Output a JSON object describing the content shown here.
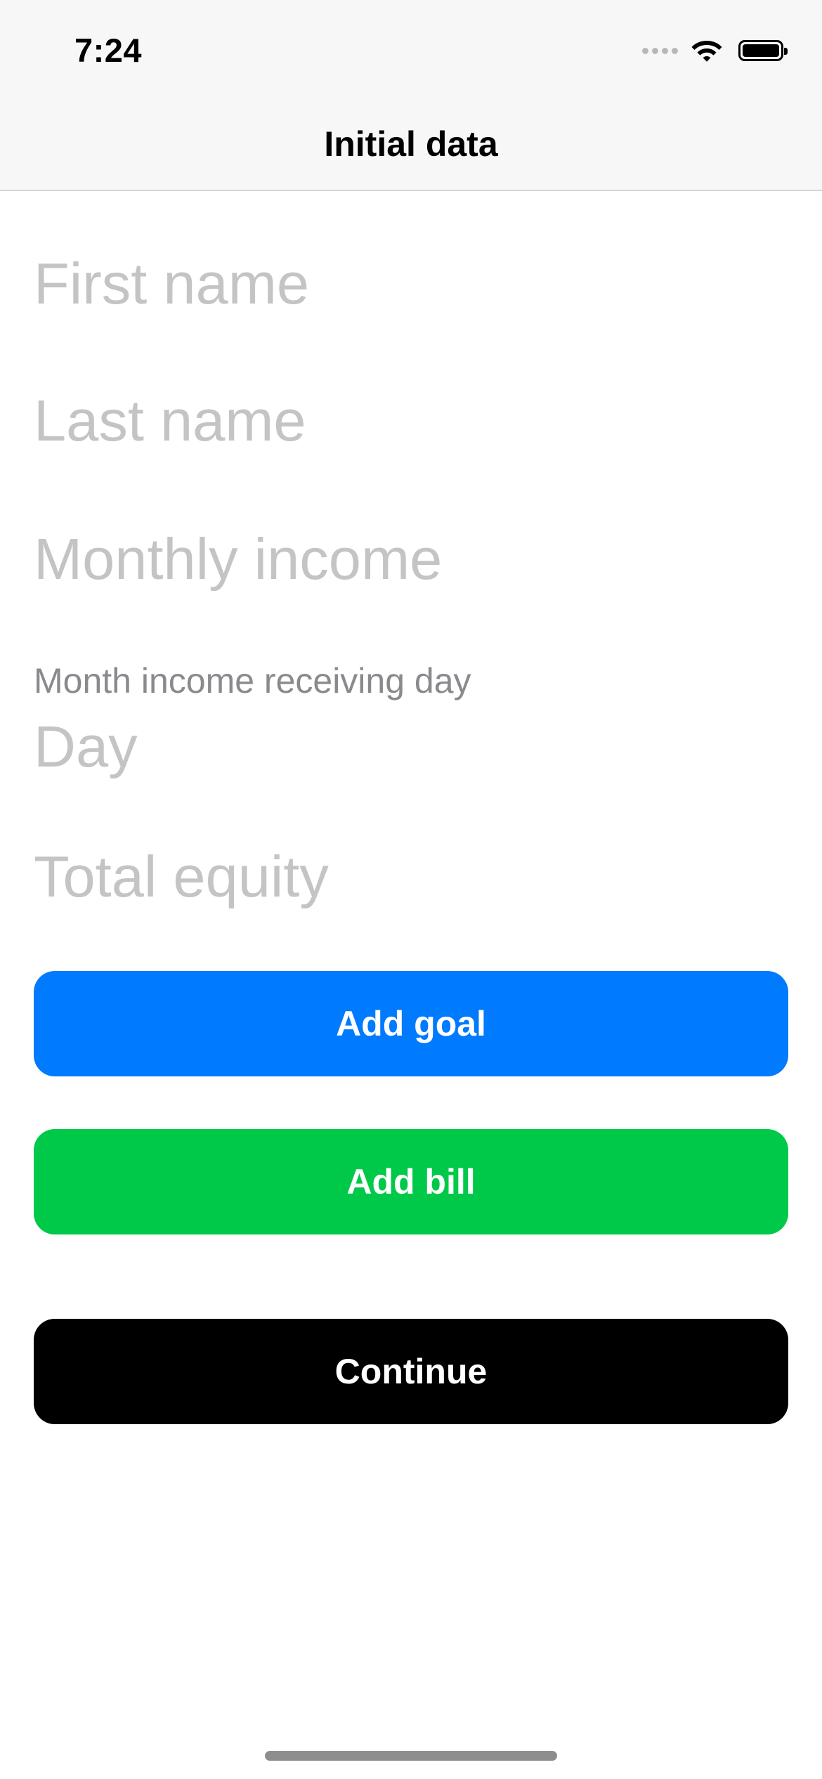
{
  "status_bar": {
    "time": "7:24"
  },
  "nav": {
    "title": "Initial data"
  },
  "form": {
    "first_name_placeholder": "First name",
    "last_name_placeholder": "Last name",
    "monthly_income_placeholder": "Monthly income",
    "income_day_caption": "Month income receiving day",
    "income_day_placeholder": "Day",
    "total_equity_placeholder": "Total equity"
  },
  "actions": {
    "add_goal_label": "Add goal",
    "add_bill_label": "Add bill",
    "continue_label": "Continue"
  },
  "colors": {
    "add_goal": "#007aff",
    "add_bill": "#00c94a",
    "continue": "#000000",
    "placeholder": "#c4c4c6"
  }
}
